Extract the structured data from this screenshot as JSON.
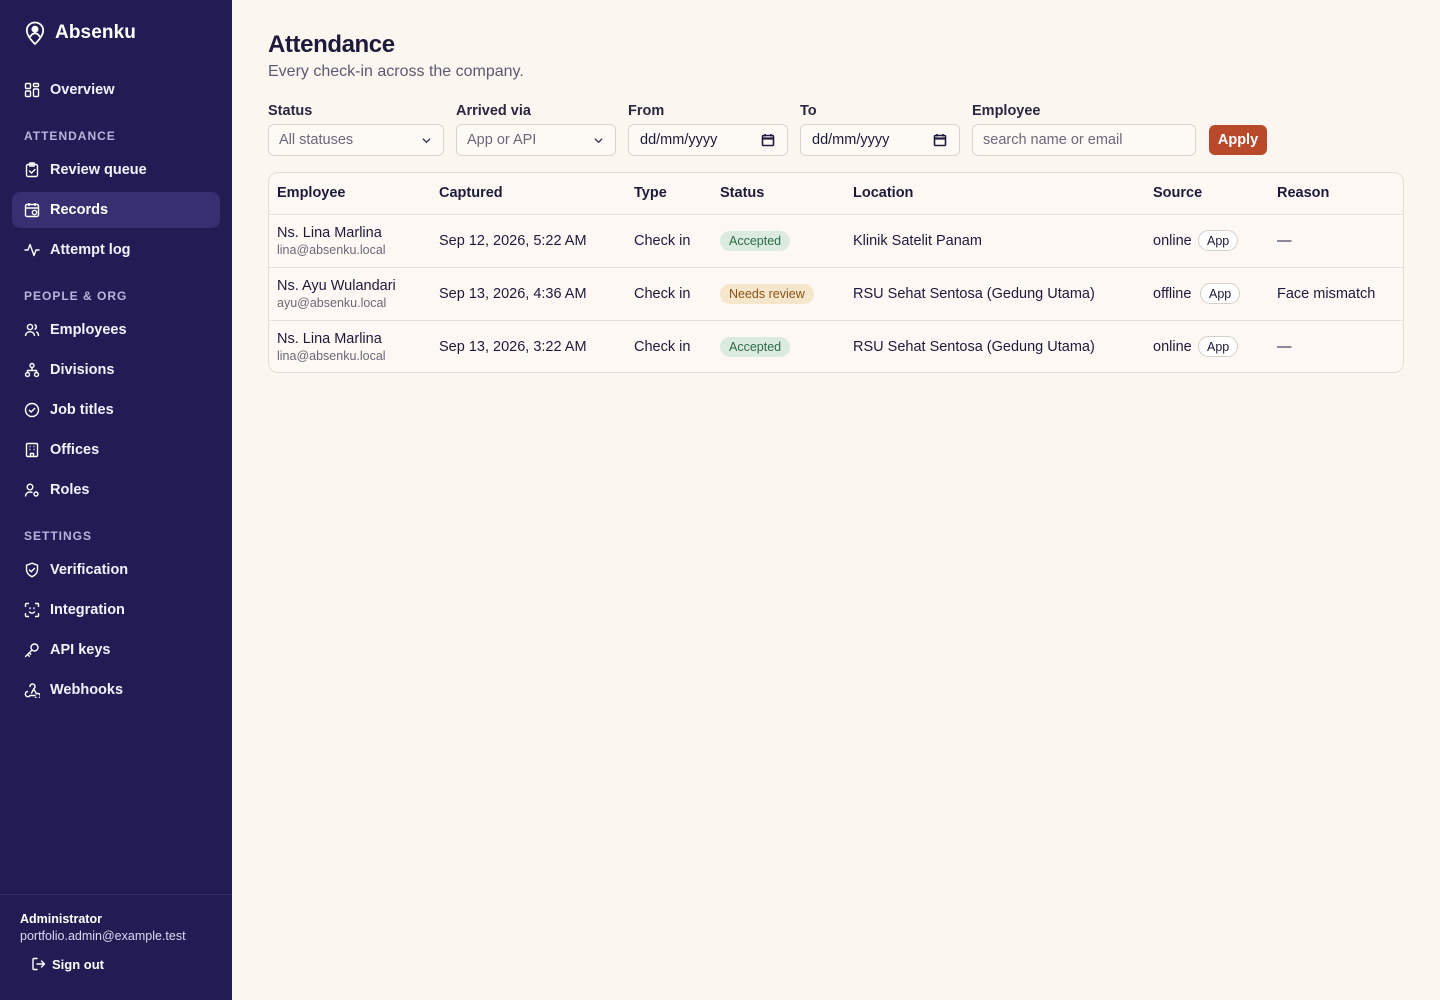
{
  "app": {
    "name": "Absenku",
    "logo_icon": "location-pin-person-icon"
  },
  "sidebar": {
    "overview": {
      "label": "Overview",
      "icon": "grid-icon"
    },
    "sections": [
      {
        "label": "ATTENDANCE",
        "items": [
          {
            "label": "Review queue",
            "icon": "clipboard-check-icon"
          },
          {
            "label": "Records",
            "icon": "calendar-icon",
            "active": true
          },
          {
            "label": "Attempt log",
            "icon": "activity-icon"
          }
        ]
      },
      {
        "label": "PEOPLE & ORG",
        "items": [
          {
            "label": "Employees",
            "icon": "users-icon"
          },
          {
            "label": "Divisions",
            "icon": "hierarchy-icon"
          },
          {
            "label": "Job titles",
            "icon": "badge-check-icon"
          },
          {
            "label": "Offices",
            "icon": "building-icon"
          },
          {
            "label": "Roles",
            "icon": "user-cog-icon"
          }
        ]
      },
      {
        "label": "SETTINGS",
        "items": [
          {
            "label": "Verification",
            "icon": "shield-check-icon"
          },
          {
            "label": "Integration",
            "icon": "scan-face-icon"
          },
          {
            "label": "API keys",
            "icon": "key-icon"
          },
          {
            "label": "Webhooks",
            "icon": "webhook-icon"
          }
        ]
      }
    ],
    "user": {
      "name": "Administrator",
      "email": "portfolio.admin@example.test",
      "signout_label": "Sign out"
    }
  },
  "page": {
    "title": "Attendance",
    "subtitle": "Every check-in across the company."
  },
  "filters": {
    "status": {
      "label": "Status",
      "value": "All statuses"
    },
    "arrived_via": {
      "label": "Arrived via",
      "value": "App or API"
    },
    "from": {
      "label": "From",
      "value": "dd/mm/yyyy"
    },
    "to": {
      "label": "To",
      "value": "dd/mm/yyyy"
    },
    "employee": {
      "label": "Employee",
      "placeholder": "search name or email"
    },
    "apply_label": "Apply"
  },
  "table": {
    "columns": [
      "Employee",
      "Captured",
      "Type",
      "Status",
      "Location",
      "Source",
      "Reason"
    ],
    "rows": [
      {
        "name": "Ns. Lina Marlina",
        "email": "lina@absenku.local",
        "captured": "Sep 12, 2026, 5:22 AM",
        "type": "Check in",
        "status": "Accepted",
        "location": "Klinik Satelit Panam",
        "source": "online",
        "source_tag": "App",
        "reason": "—"
      },
      {
        "name": "Ns. Ayu Wulandari",
        "email": "ayu@absenku.local",
        "captured": "Sep 13, 2026, 4:36 AM",
        "type": "Check in",
        "status": "Needs review",
        "location": "RSU Sehat Sentosa (Gedung Utama)",
        "source": "offline",
        "source_tag": "App",
        "reason": "Face mismatch"
      },
      {
        "name": "Ns. Lina Marlina",
        "email": "lina@absenku.local",
        "captured": "Sep 13, 2026, 3:22 AM",
        "type": "Check in",
        "status": "Accepted",
        "location": "RSU Sehat Sentosa (Gedung Utama)",
        "source": "online",
        "source_tag": "App",
        "reason": "—"
      }
    ]
  },
  "colors": {
    "sidebar_bg": "#221c54",
    "accent": "#b8492b",
    "accepted": "#2d6b46",
    "needs_review": "#8a5416"
  }
}
